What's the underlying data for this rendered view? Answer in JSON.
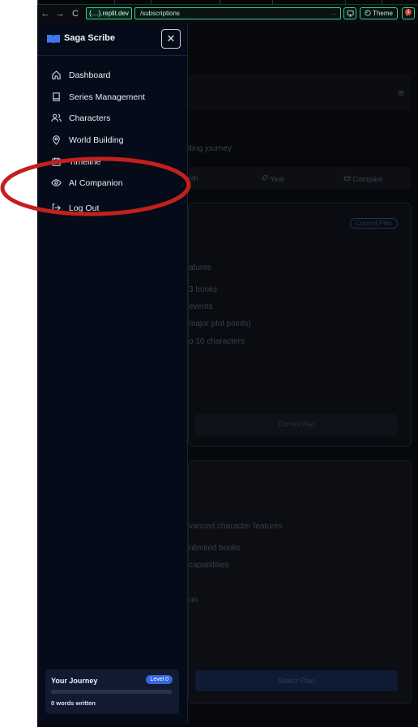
{
  "browser": {
    "back": "←",
    "forward": "→",
    "reload": "C",
    "host": "{....}.replit.dev",
    "path": "/subscriptions",
    "go": "→",
    "theme_label": "Theme",
    "notification_count": "1"
  },
  "sidebar": {
    "title": "Saga Scribe",
    "close": "✕",
    "items": [
      {
        "label": "Dashboard",
        "icon": "home-icon"
      },
      {
        "label": "Series Management",
        "icon": "book-icon"
      },
      {
        "label": "Characters",
        "icon": "users-icon"
      },
      {
        "label": "World Building",
        "icon": "map-pin-icon"
      },
      {
        "label": "Timeline",
        "icon": "calendar-icon"
      },
      {
        "label": "AI Companion",
        "icon": "eye-icon"
      },
      {
        "label": "Log Out",
        "icon": "logout-icon"
      }
    ],
    "journey": {
      "title": "Your Journey",
      "level": "Level 0",
      "progress": 0,
      "words": "0 words written"
    }
  },
  "background": {
    "subtitle_fragment": "iting journey",
    "tabs": [
      "nth",
      "Year",
      "Compare"
    ],
    "card1": {
      "badge": "Current Plan",
      "features_heading": "atures",
      "features": [
        "3 books",
        "events",
        "major plot points)",
        "o 10 characters"
      ],
      "button": "Current Plan"
    },
    "card2": {
      "features_heading": "vanced character features",
      "features": [
        "nlimited books",
        "capabilities",
        "on"
      ],
      "button": "Select Plan"
    }
  },
  "colors": {
    "accent": "#3568e0",
    "annotation": "#c3201e",
    "browser_accent": "#2bd48f"
  }
}
